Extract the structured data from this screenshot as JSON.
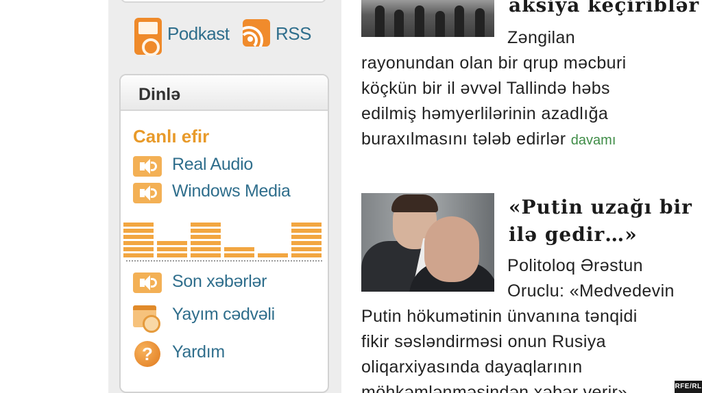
{
  "sidebar": {
    "links": {
      "podcast_label": "Podkast",
      "rss_label": "RSS"
    },
    "listen_box": {
      "title": "Dinlə",
      "live_title": "Canlı efir",
      "items": [
        {
          "label": "Real Audio",
          "icon": "speaker-icon"
        },
        {
          "label": "Windows Media",
          "icon": "speaker-icon"
        }
      ],
      "extra_items": [
        {
          "label": "Son xəbərlər",
          "icon": "speaker-icon"
        },
        {
          "label": "Yayım cədvəli",
          "icon": "calendar-icon"
        },
        {
          "label": "Yardım",
          "icon": "help-icon"
        }
      ],
      "equalizer_levels": [
        6,
        3,
        6,
        2,
        1,
        6
      ]
    }
  },
  "main": {
    "story1": {
      "headline": "aksiya keçiriblər",
      "lines": [
        "Zəngilan",
        "rayonundan olan bir qrup məcburi",
        "köçkün bir il əvvəl Tallində həbs",
        "edilmiş həmyerlilərinin azadlığa",
        "buraxılmasını tələb edirlər"
      ],
      "more_label": "davamı"
    },
    "story2": {
      "headline_lines": [
        "«Putin uzağı bir",
        "ilə gedir…»"
      ],
      "lines": [
        "Politoloq Ərəstun",
        "Oruclu: «Medvedevin",
        "Putin hökumətinin ünvanına tənqidi",
        "fikir səsləndirməsi onun Rusiya",
        "oliqarxiyasında dayaqlarının",
        "möhkəmlənməsindən xəbər verir»"
      ]
    }
  },
  "badge": "RFE/RL",
  "colors": {
    "accent_orange": "#e89a2a",
    "link_blue": "#2f6e8c",
    "more_green": "#3e8c46",
    "sidebar_bg": "#ededed"
  }
}
